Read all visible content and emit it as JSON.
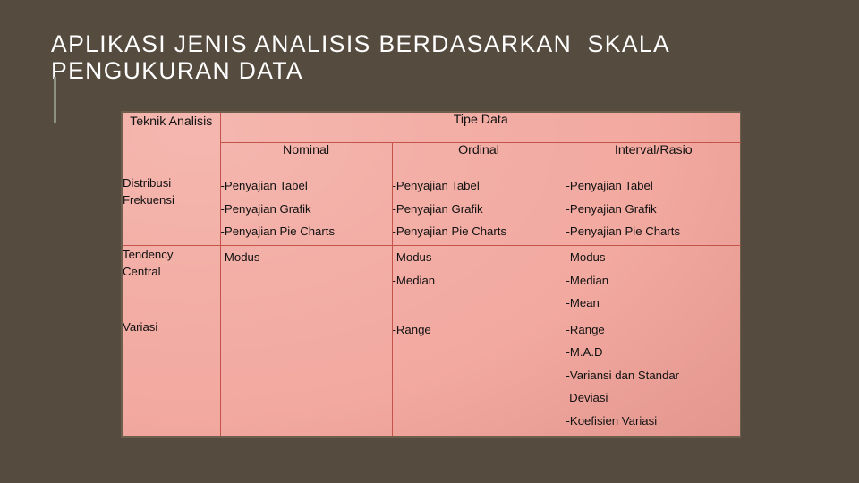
{
  "slide": {
    "background_color": "#554b3e",
    "accent_bar_color": "#8d9182",
    "title": {
      "line1": "APLIKASI JENIS ANALISIS BERDASARKAN  SKALA",
      "line2": "PENGUKURAN DATA",
      "color": "#ffffff"
    }
  },
  "table": {
    "background_color": "#f2a9a0",
    "grid_line_color": "#c4544a",
    "border_color": "#6d5e4d",
    "header": {
      "row_label_header": {
        "line1": "Teknik",
        "line2": "Analisis"
      },
      "group_header": "Tipe Data",
      "columns": [
        "Nominal",
        "Ordinal",
        "Interval/Rasio"
      ]
    },
    "rows": [
      {
        "label": {
          "line1": "Distribusi",
          "line2": "Frekuensi"
        },
        "nominal": [
          "-Penyajian Tabel",
          "-Penyajian Grafik",
          "-Penyajian Pie Charts"
        ],
        "ordinal": [
          "-Penyajian Tabel",
          "-Penyajian Grafik",
          "-Penyajian Pie Charts"
        ],
        "interval": [
          "-Penyajian Tabel",
          "-Penyajian Grafik",
          "-Penyajian Pie Charts"
        ]
      },
      {
        "label": {
          "line1": "Tendency",
          "line2": "Central"
        },
        "nominal": [
          "-Modus"
        ],
        "ordinal": [
          "-Modus",
          "-Median"
        ],
        "interval": [
          "-Modus",
          "-Median",
          "-Mean"
        ]
      },
      {
        "label": {
          "line1": "Variasi",
          "line2": ""
        },
        "nominal": [],
        "ordinal": [
          "-Range"
        ],
        "interval": [
          "-Range",
          "-M.A.D",
          "-Variansi dan Standar",
          " Deviasi",
          "-Koefisien Variasi"
        ]
      }
    ]
  }
}
